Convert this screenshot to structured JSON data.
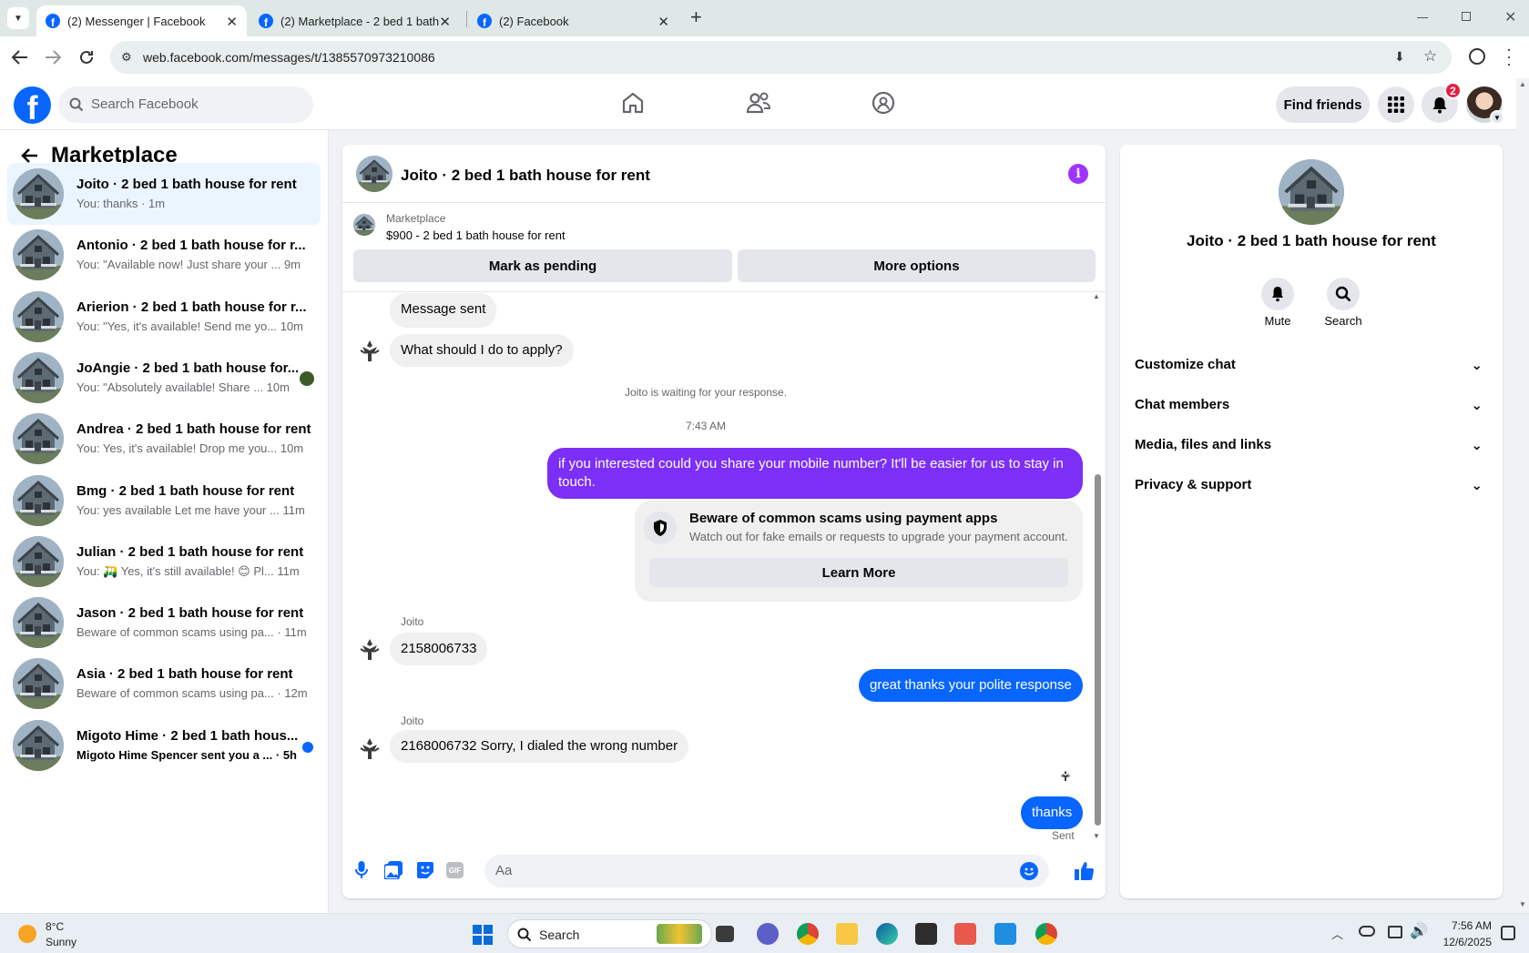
{
  "browser": {
    "tabs": [
      {
        "title": "(2) Messenger | Facebook",
        "active": true
      },
      {
        "title": "(2) Marketplace - 2 bed 1 bath",
        "active": false
      },
      {
        "title": "(2) Facebook",
        "active": false
      }
    ],
    "url": "web.facebook.com/messages/t/1385570973210086"
  },
  "fb_header": {
    "search_placeholder": "Search Facebook",
    "find_friends": "Find friends",
    "notifications_count": "2"
  },
  "sidebar": {
    "title": "Marketplace",
    "conversations": [
      {
        "title": "Joito · 2 bed 1 bath house for rent",
        "preview": "You: thanks · 1m",
        "time": ""
      },
      {
        "title": "Antonio · 2 bed 1 bath house for r...",
        "preview": "You: \"Available now! Just share your ...",
        "time": "9m"
      },
      {
        "title": "Arierion · 2 bed 1 bath house for r...",
        "preview": "You: \"Yes, it's available! Send me yo...",
        "time": "10m"
      },
      {
        "title": "JoAngie · 2 bed 1 bath house for...",
        "preview": "You: \"Absolutely available! Share ...",
        "time": "10m"
      },
      {
        "title": "Andrea · 2 bed 1 bath house for rent",
        "preview": "You: Yes, it's available! Drop me you...",
        "time": "10m"
      },
      {
        "title": "Bmg · 2 bed 1 bath house for rent",
        "preview": "You: yes available Let me have your ...",
        "time": "11m"
      },
      {
        "title": "Julian · 2 bed 1 bath house for rent",
        "preview": "You: 🛺 Yes, it's still available! 😊 Pl...",
        "time": "11m"
      },
      {
        "title": "Jason · 2 bed 1 bath house for rent",
        "preview": "Beware of common scams using pa...",
        "time": "· 11m"
      },
      {
        "title": "Asia · 2 bed 1 bath house for rent",
        "preview": "Beware of common scams using pa...",
        "time": "· 12m"
      },
      {
        "title": "Migoto Hime · 2 bed 1 bath hous...",
        "preview": "Migoto Hime Spencer sent you a ...",
        "time": "· 5h"
      }
    ]
  },
  "chat": {
    "title": "Joito · 2 bed 1 bath house for rent",
    "listing_source": "Marketplace",
    "listing_text": "$900 - 2 bed 1 bath house for rent",
    "mark_pending": "Mark as pending",
    "more_options": "More options",
    "messages": {
      "m1": "Message sent",
      "m2": "What should I do to apply?",
      "waiting": "Joito is waiting for your response.",
      "time": "7:43 AM",
      "m3": "if you interested  could you share your mobile number? It'll be easier for us to stay in touch.",
      "scam_title": "Beware of common scams using payment apps",
      "scam_desc": "Watch out for fake emails or requests to upgrade your payment account.",
      "learn_more": "Learn More",
      "sender1": "Joito",
      "m4": "2158006733",
      "m5": "great thanks your polite response",
      "sender2": "Joito",
      "m6": "2168006732 Sorry, I dialed the wrong number",
      "m7": "thanks",
      "status": "Sent"
    },
    "composer_placeholder": "Aa",
    "gif_label": "GIF"
  },
  "details": {
    "title": "Joito · 2 bed 1 bath house for rent",
    "mute": "Mute",
    "search": "Search",
    "sections": [
      "Customize chat",
      "Chat members",
      "Media, files and links",
      "Privacy & support"
    ]
  },
  "taskbar": {
    "temp": "8°C",
    "weather": "Sunny",
    "search": "Search",
    "time": "7:56 AM",
    "date": "12/6/2025"
  },
  "colors": {
    "accent": "#0866ff",
    "purple": "#7b2ff7",
    "info": "#a033ff"
  }
}
